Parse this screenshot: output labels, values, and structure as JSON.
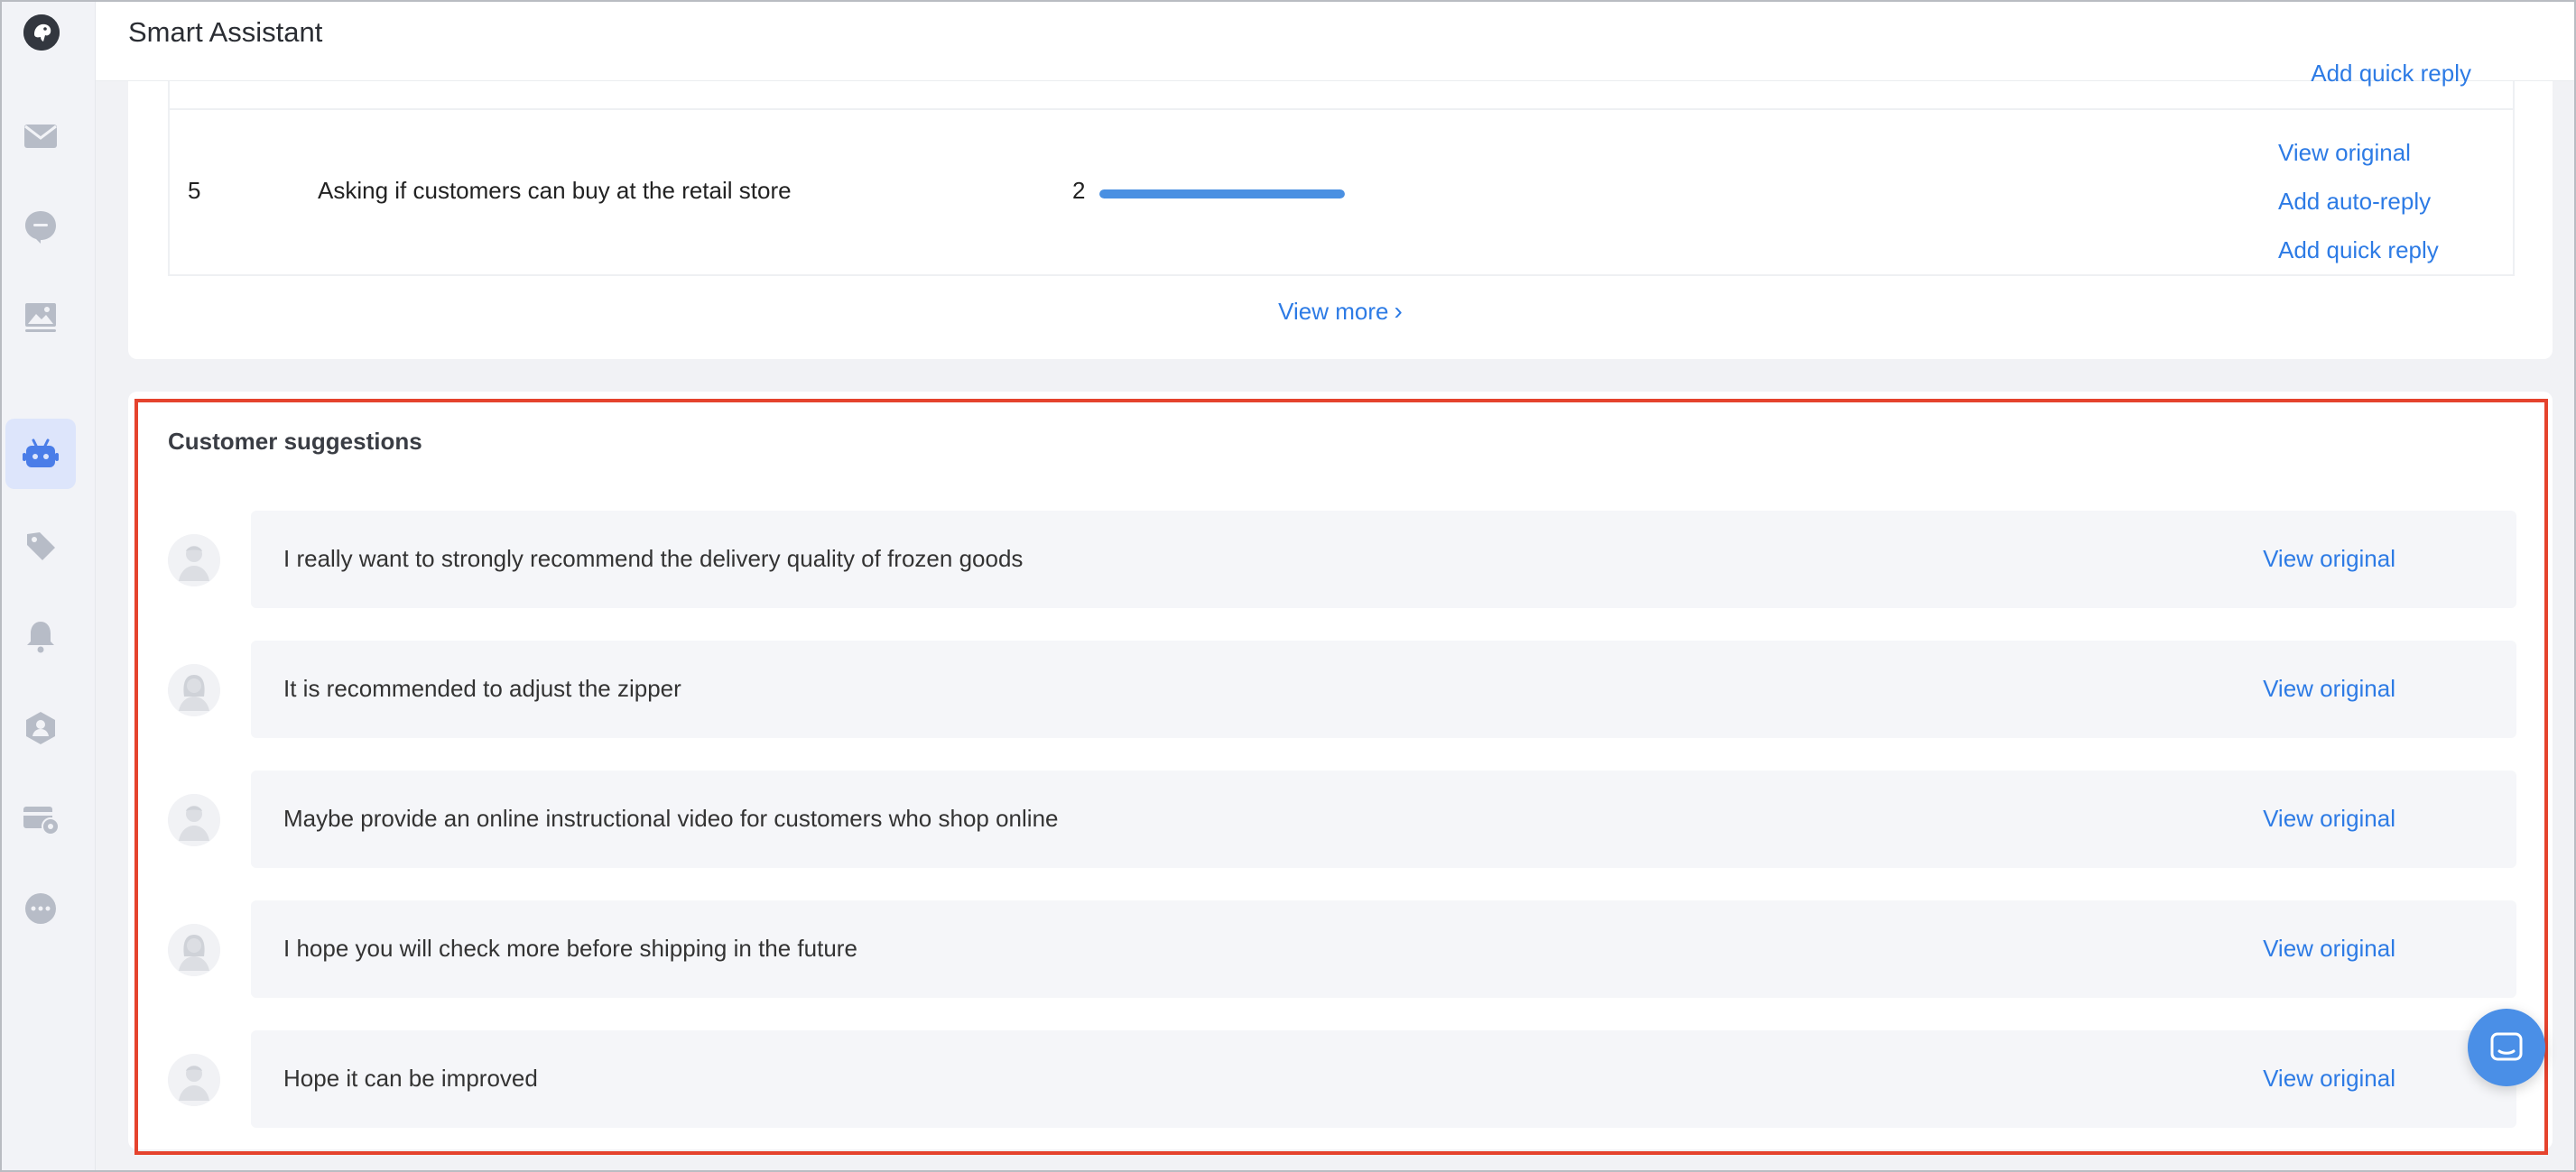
{
  "app": {
    "title": "Smart Assistant"
  },
  "sidebar": {
    "items": [
      {
        "icon": "mail-icon"
      },
      {
        "icon": "chat-bubble-icon"
      },
      {
        "icon": "image-icon"
      },
      {
        "icon": "robot-icon",
        "active": true
      },
      {
        "icon": "tag-icon"
      },
      {
        "icon": "bell-icon"
      },
      {
        "icon": "user-shield-icon"
      },
      {
        "icon": "card-settings-icon"
      },
      {
        "icon": "more-icon"
      }
    ]
  },
  "top_table": {
    "cut_off_link": "Add quick reply",
    "row": {
      "rank": "5",
      "topic": "Asking if customers can buy at the retail store",
      "count": "2",
      "bar_fraction": 1.0,
      "links": [
        "View original",
        "Add auto-reply",
        "Add quick reply"
      ]
    },
    "view_more": "View more"
  },
  "suggestions": {
    "title": "Customer suggestions",
    "link_label": "View original",
    "items": [
      {
        "text": "I really want to strongly recommend the delivery quality of frozen goods",
        "avatar": "male-avatar-icon"
      },
      {
        "text": "It is recommended to adjust the zipper",
        "avatar": "female-avatar-icon"
      },
      {
        "text": "Maybe provide an online instructional video for customers who shop online",
        "avatar": "male-avatar-icon"
      },
      {
        "text": "I hope you will check more before shipping in the future",
        "avatar": "female-avatar-icon"
      },
      {
        "text": "Hope it can be improved",
        "avatar": "male-avatar-icon"
      }
    ]
  },
  "colors": {
    "accent": "#2d7be5",
    "highlight_border": "#e5432d",
    "active_nav": "#4a7de8"
  },
  "chat_widget": {
    "icon": "chat-widget-icon"
  }
}
